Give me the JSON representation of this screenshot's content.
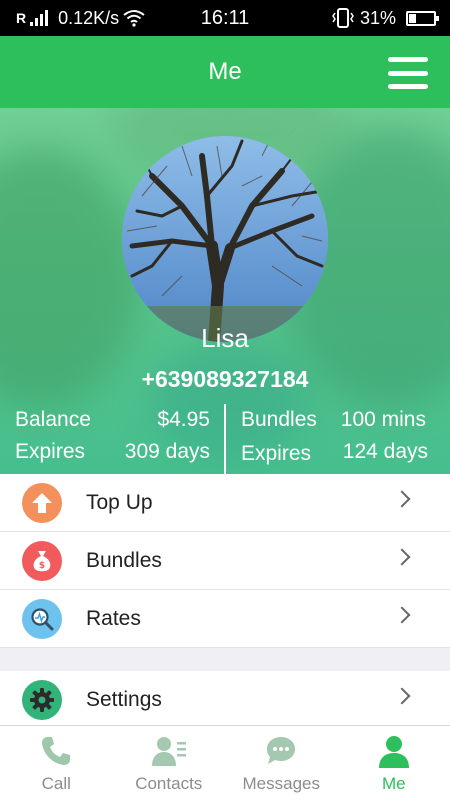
{
  "status_bar": {
    "network_speed": "0.12K/s",
    "time": "16:11",
    "battery": "31%",
    "battery_level": 0.31,
    "signal_label": "R"
  },
  "header": {
    "title": "Me"
  },
  "profile": {
    "name": "Lisa",
    "phone": "+639089327184",
    "balance_label": "Balance",
    "balance_value": "$4.95",
    "balance_expires_label": "Expires",
    "balance_expires_value": "309 days",
    "bundles_label": "Bundles",
    "bundles_value": "100 mins",
    "bundles_expires_label": "Expires",
    "bundles_expires_value": "124 days"
  },
  "menu": {
    "items": [
      {
        "label": "Top Up",
        "icon": "arrow-up-icon",
        "color": "#f3905c"
      },
      {
        "label": "Bundles",
        "icon": "money-bag-icon",
        "color": "#f25b5b"
      },
      {
        "label": "Rates",
        "icon": "magnifier-icon",
        "color": "#6ec3ee"
      },
      {
        "label": "Settings",
        "icon": "gear-icon",
        "color": "#31b37a"
      }
    ]
  },
  "tabs": [
    {
      "label": "Call",
      "icon": "phone-icon",
      "active": false
    },
    {
      "label": "Contacts",
      "icon": "contacts-icon",
      "active": false
    },
    {
      "label": "Messages",
      "icon": "chat-icon",
      "active": false
    },
    {
      "label": "Me",
      "icon": "person-icon",
      "active": true
    }
  ],
  "colors": {
    "brand": "#2dbf5b",
    "inactive": "#8c8c8c",
    "divider": "#e3e3e3"
  }
}
